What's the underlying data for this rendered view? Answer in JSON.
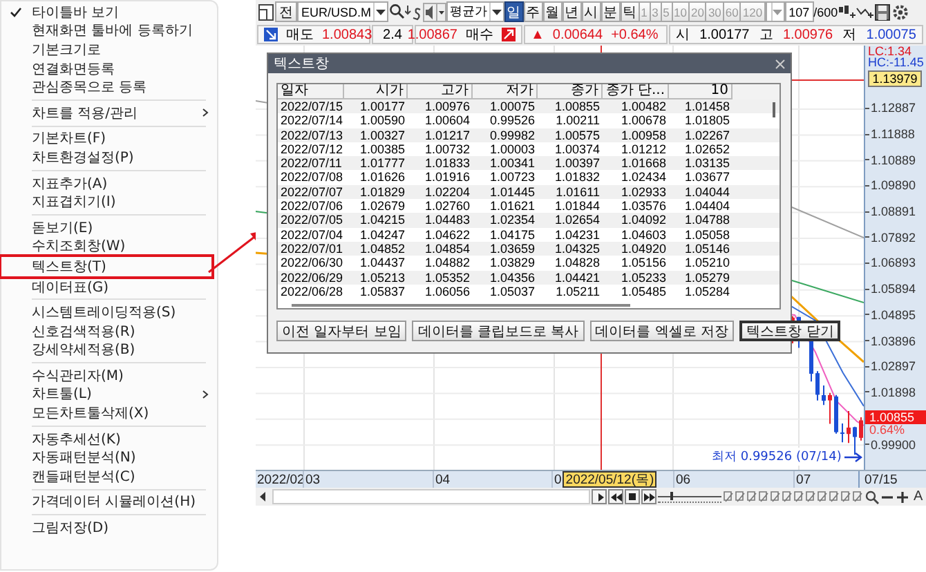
{
  "context_menu": {
    "items": [
      {
        "kind": "item",
        "label": "타이틀바 보기",
        "checked": true,
        "submenu": false,
        "highlighted": false
      },
      {
        "kind": "item",
        "label": "현재화면 툴바에 등록하기",
        "checked": false,
        "submenu": false,
        "highlighted": false
      },
      {
        "kind": "item",
        "label": "기본크기로",
        "checked": false,
        "submenu": false,
        "highlighted": false
      },
      {
        "kind": "item",
        "label": "연결화면등록",
        "checked": false,
        "submenu": false,
        "highlighted": false
      },
      {
        "kind": "item",
        "label": "관심종목으로 등록",
        "checked": false,
        "submenu": false,
        "highlighted": false
      },
      {
        "kind": "separator"
      },
      {
        "kind": "item",
        "label": "차트를 적용/관리",
        "checked": false,
        "submenu": true,
        "highlighted": false
      },
      {
        "kind": "separator"
      },
      {
        "kind": "item",
        "label": "기본차트(F)",
        "checked": false,
        "submenu": false,
        "highlighted": false
      },
      {
        "kind": "item",
        "label": "차트환경설정(P)",
        "checked": false,
        "submenu": false,
        "highlighted": false
      },
      {
        "kind": "separator"
      },
      {
        "kind": "item",
        "label": "지표추가(A)",
        "checked": false,
        "submenu": false,
        "highlighted": false
      },
      {
        "kind": "item",
        "label": "지표겹치기(I)",
        "checked": false,
        "submenu": false,
        "highlighted": false
      },
      {
        "kind": "separator"
      },
      {
        "kind": "item",
        "label": "돋보기(E)",
        "checked": false,
        "submenu": false,
        "highlighted": false
      },
      {
        "kind": "item",
        "label": "수치조회창(W)",
        "checked": false,
        "submenu": false,
        "highlighted": false
      },
      {
        "kind": "item",
        "label": "텍스트창(T)",
        "checked": false,
        "submenu": false,
        "highlighted": true
      },
      {
        "kind": "item",
        "label": "데이터표(G)",
        "checked": false,
        "submenu": false,
        "highlighted": false
      },
      {
        "kind": "separator"
      },
      {
        "kind": "item",
        "label": "시스템트레이딩적용(S)",
        "checked": false,
        "submenu": false,
        "highlighted": false
      },
      {
        "kind": "item",
        "label": "신호검색적용(R)",
        "checked": false,
        "submenu": false,
        "highlighted": false
      },
      {
        "kind": "item",
        "label": "강세약세적용(B)",
        "checked": false,
        "submenu": false,
        "highlighted": false
      },
      {
        "kind": "separator"
      },
      {
        "kind": "item",
        "label": "수식관리자(M)",
        "checked": false,
        "submenu": false,
        "highlighted": false
      },
      {
        "kind": "item",
        "label": "차트툴(L)",
        "checked": false,
        "submenu": true,
        "highlighted": false
      },
      {
        "kind": "item",
        "label": "모든차트툴삭제(X)",
        "checked": false,
        "submenu": false,
        "highlighted": false
      },
      {
        "kind": "separator"
      },
      {
        "kind": "item",
        "label": "자동추세선(K)",
        "checked": false,
        "submenu": false,
        "highlighted": false
      },
      {
        "kind": "item",
        "label": "자동패턴분석(N)",
        "checked": false,
        "submenu": false,
        "highlighted": false
      },
      {
        "kind": "item",
        "label": "캔들패턴분석(C)",
        "checked": false,
        "submenu": false,
        "highlighted": false
      },
      {
        "kind": "separator"
      },
      {
        "kind": "item",
        "label": "가격데이터 시뮬레이션(H)",
        "checked": false,
        "submenu": false,
        "highlighted": false
      },
      {
        "kind": "separator"
      },
      {
        "kind": "item",
        "label": "그림저장(D)",
        "checked": false,
        "submenu": false,
        "highlighted": false
      }
    ]
  },
  "chart_window": {
    "toolbar": {
      "market_button": "전",
      "symbol": "EUR/USD.M",
      "price_type": "평균가",
      "periods": [
        {
          "label": "일",
          "selected": true
        },
        {
          "label": "주",
          "selected": false
        },
        {
          "label": "월",
          "selected": false
        },
        {
          "label": "년",
          "selected": false
        },
        {
          "label": "시",
          "selected": false
        },
        {
          "label": "분",
          "selected": false
        },
        {
          "label": "틱",
          "selected": false
        }
      ],
      "intervals": [
        "1",
        "3",
        "5",
        "10",
        "20",
        "30",
        "60",
        "120"
      ],
      "count": "107",
      "count_max": "/600"
    },
    "quote_bar": {
      "sell_label": "매도",
      "sell_price": "1.00843",
      "spread": "2.4",
      "buy_price": "1.00867",
      "buy_label": "매수",
      "change_sign": "▲",
      "change": "0.00644",
      "change_rate": "+0.64%",
      "open_label": "시",
      "open": "1.00177",
      "high_label": "고",
      "high": "1.00976",
      "low_label": "저",
      "low": "1.00075"
    },
    "price_axis": {
      "lc": "LC:1.34",
      "hc": "HC:-11.45",
      "period_high": "1.13979",
      "ticks": [
        "1.12887",
        "1.11888",
        "1.10889",
        "1.09890",
        "1.08891",
        "1.07892",
        "1.06893",
        "1.05894",
        "1.04895",
        "1.03896",
        "1.02897",
        "1.01898",
        "0.99900"
      ],
      "last_price": "1.00855",
      "last_change": "0.64%"
    },
    "low_marker": "최저 0.99526 (07/14)",
    "date_axis": {
      "labels": [
        "2022/02",
        "03",
        "04",
        "0",
        "06",
        "07"
      ],
      "crosshair_date": "2022/05/12(목)",
      "last_date": "07/15"
    },
    "bottom_bar": {
      "zoom_slider": {
        "level": 0.2
      },
      "font_button": "A"
    }
  },
  "text_dialog": {
    "title": "텍스트창",
    "columns": [
      "일자",
      "시가",
      "고가",
      "저가",
      "종가",
      "종가 단...",
      "10"
    ],
    "rows": [
      [
        "2022/07/15",
        "1.00177",
        "1.00976",
        "1.00075",
        "1.00855",
        "1.00482",
        "1.01458"
      ],
      [
        "2022/07/14",
        "1.00590",
        "1.00604",
        "0.99526",
        "1.00211",
        "1.00678",
        "1.01805"
      ],
      [
        "2022/07/13",
        "1.00327",
        "1.01217",
        "0.99982",
        "1.00575",
        "1.00958",
        "1.02267"
      ],
      [
        "2022/07/12",
        "1.00385",
        "1.00732",
        "1.00003",
        "1.00374",
        "1.01212",
        "1.02652"
      ],
      [
        "2022/07/11",
        "1.01777",
        "1.01833",
        "1.00341",
        "1.00397",
        "1.01668",
        "1.03135"
      ],
      [
        "2022/07/08",
        "1.01626",
        "1.01916",
        "1.00723",
        "1.01832",
        "1.02434",
        "1.03677"
      ],
      [
        "2022/07/07",
        "1.01829",
        "1.02204",
        "1.01445",
        "1.01611",
        "1.02933",
        "1.04044"
      ],
      [
        "2022/07/06",
        "1.02679",
        "1.02760",
        "1.01621",
        "1.01844",
        "1.03576",
        "1.04404"
      ],
      [
        "2022/07/05",
        "1.04215",
        "1.04483",
        "1.02354",
        "1.02654",
        "1.04092",
        "1.04788"
      ],
      [
        "2022/07/04",
        "1.04247",
        "1.04622",
        "1.04175",
        "1.04231",
        "1.04603",
        "1.05058"
      ],
      [
        "2022/07/01",
        "1.04852",
        "1.04854",
        "1.03659",
        "1.04325",
        "1.04920",
        "1.05146"
      ],
      [
        "2022/06/30",
        "1.04437",
        "1.04882",
        "1.03829",
        "1.04828",
        "1.05156",
        "1.05210"
      ],
      [
        "2022/06/29",
        "1.05213",
        "1.05352",
        "1.04356",
        "1.04421",
        "1.05233",
        "1.05279"
      ],
      [
        "2022/06/28",
        "1.05837",
        "1.06056",
        "1.05037",
        "1.05211",
        "1.05485",
        "1.05284"
      ]
    ],
    "buttons": [
      {
        "label": "이전 일자부터 보임",
        "default": false
      },
      {
        "label": "데이터를 클립보드로 복사",
        "default": false
      },
      {
        "label": "데이터를 엑셀로 저장",
        "default": false
      },
      {
        "label": "텍스트창 닫기",
        "default": true
      }
    ]
  }
}
